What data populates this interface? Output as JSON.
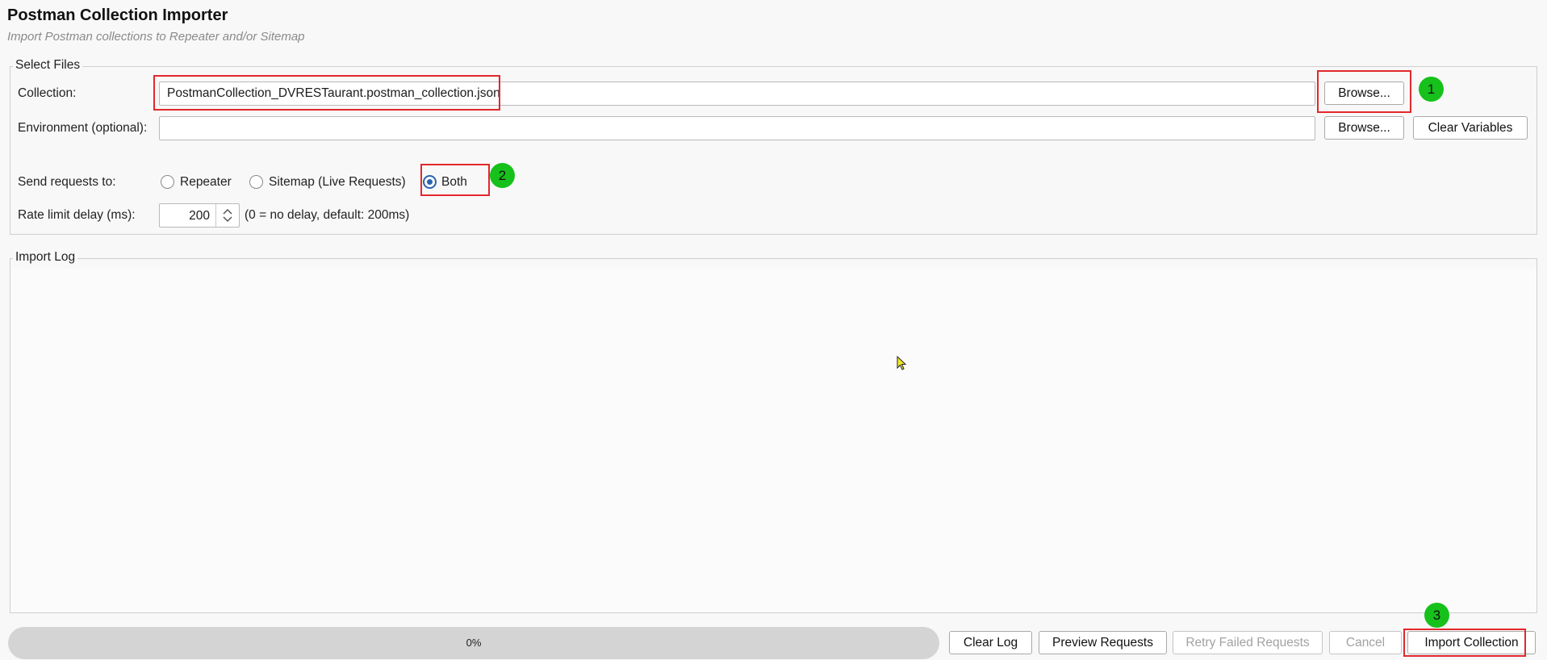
{
  "header": {
    "title": "Postman Collection Importer",
    "subtitle": "Import Postman collections to Repeater and/or Sitemap"
  },
  "select_files": {
    "legend": "Select Files",
    "collection_label": "Collection:",
    "collection_value": "PostmanCollection_DVRESTaurant.postman_collection.json",
    "environment_label": "Environment (optional):",
    "environment_value": "",
    "browse_label": "Browse...",
    "clear_variables_label": "Clear Variables",
    "send_to_label": "Send requests to:",
    "send_to_options": [
      "Repeater",
      "Sitemap (Live Requests)",
      "Both"
    ],
    "send_to_selected": "Both",
    "rate_label": "Rate limit delay (ms):",
    "rate_value": "200",
    "rate_hint": "(0 = no delay, default: 200ms)"
  },
  "import_log": {
    "legend": "Import Log",
    "content": ""
  },
  "footer": {
    "progress_text": "0%",
    "progress_value": 0,
    "buttons": {
      "clear_log": "Clear Log",
      "preview": "Preview Requests",
      "retry": "Retry Failed Requests",
      "cancel": "Cancel",
      "import": "Import Collection"
    }
  },
  "annotations": [
    "1",
    "2",
    "3"
  ],
  "colors": {
    "annotation_box": "#e2282d",
    "annotation_badge": "#16c11b",
    "radio_selected": "#2a65ad"
  }
}
